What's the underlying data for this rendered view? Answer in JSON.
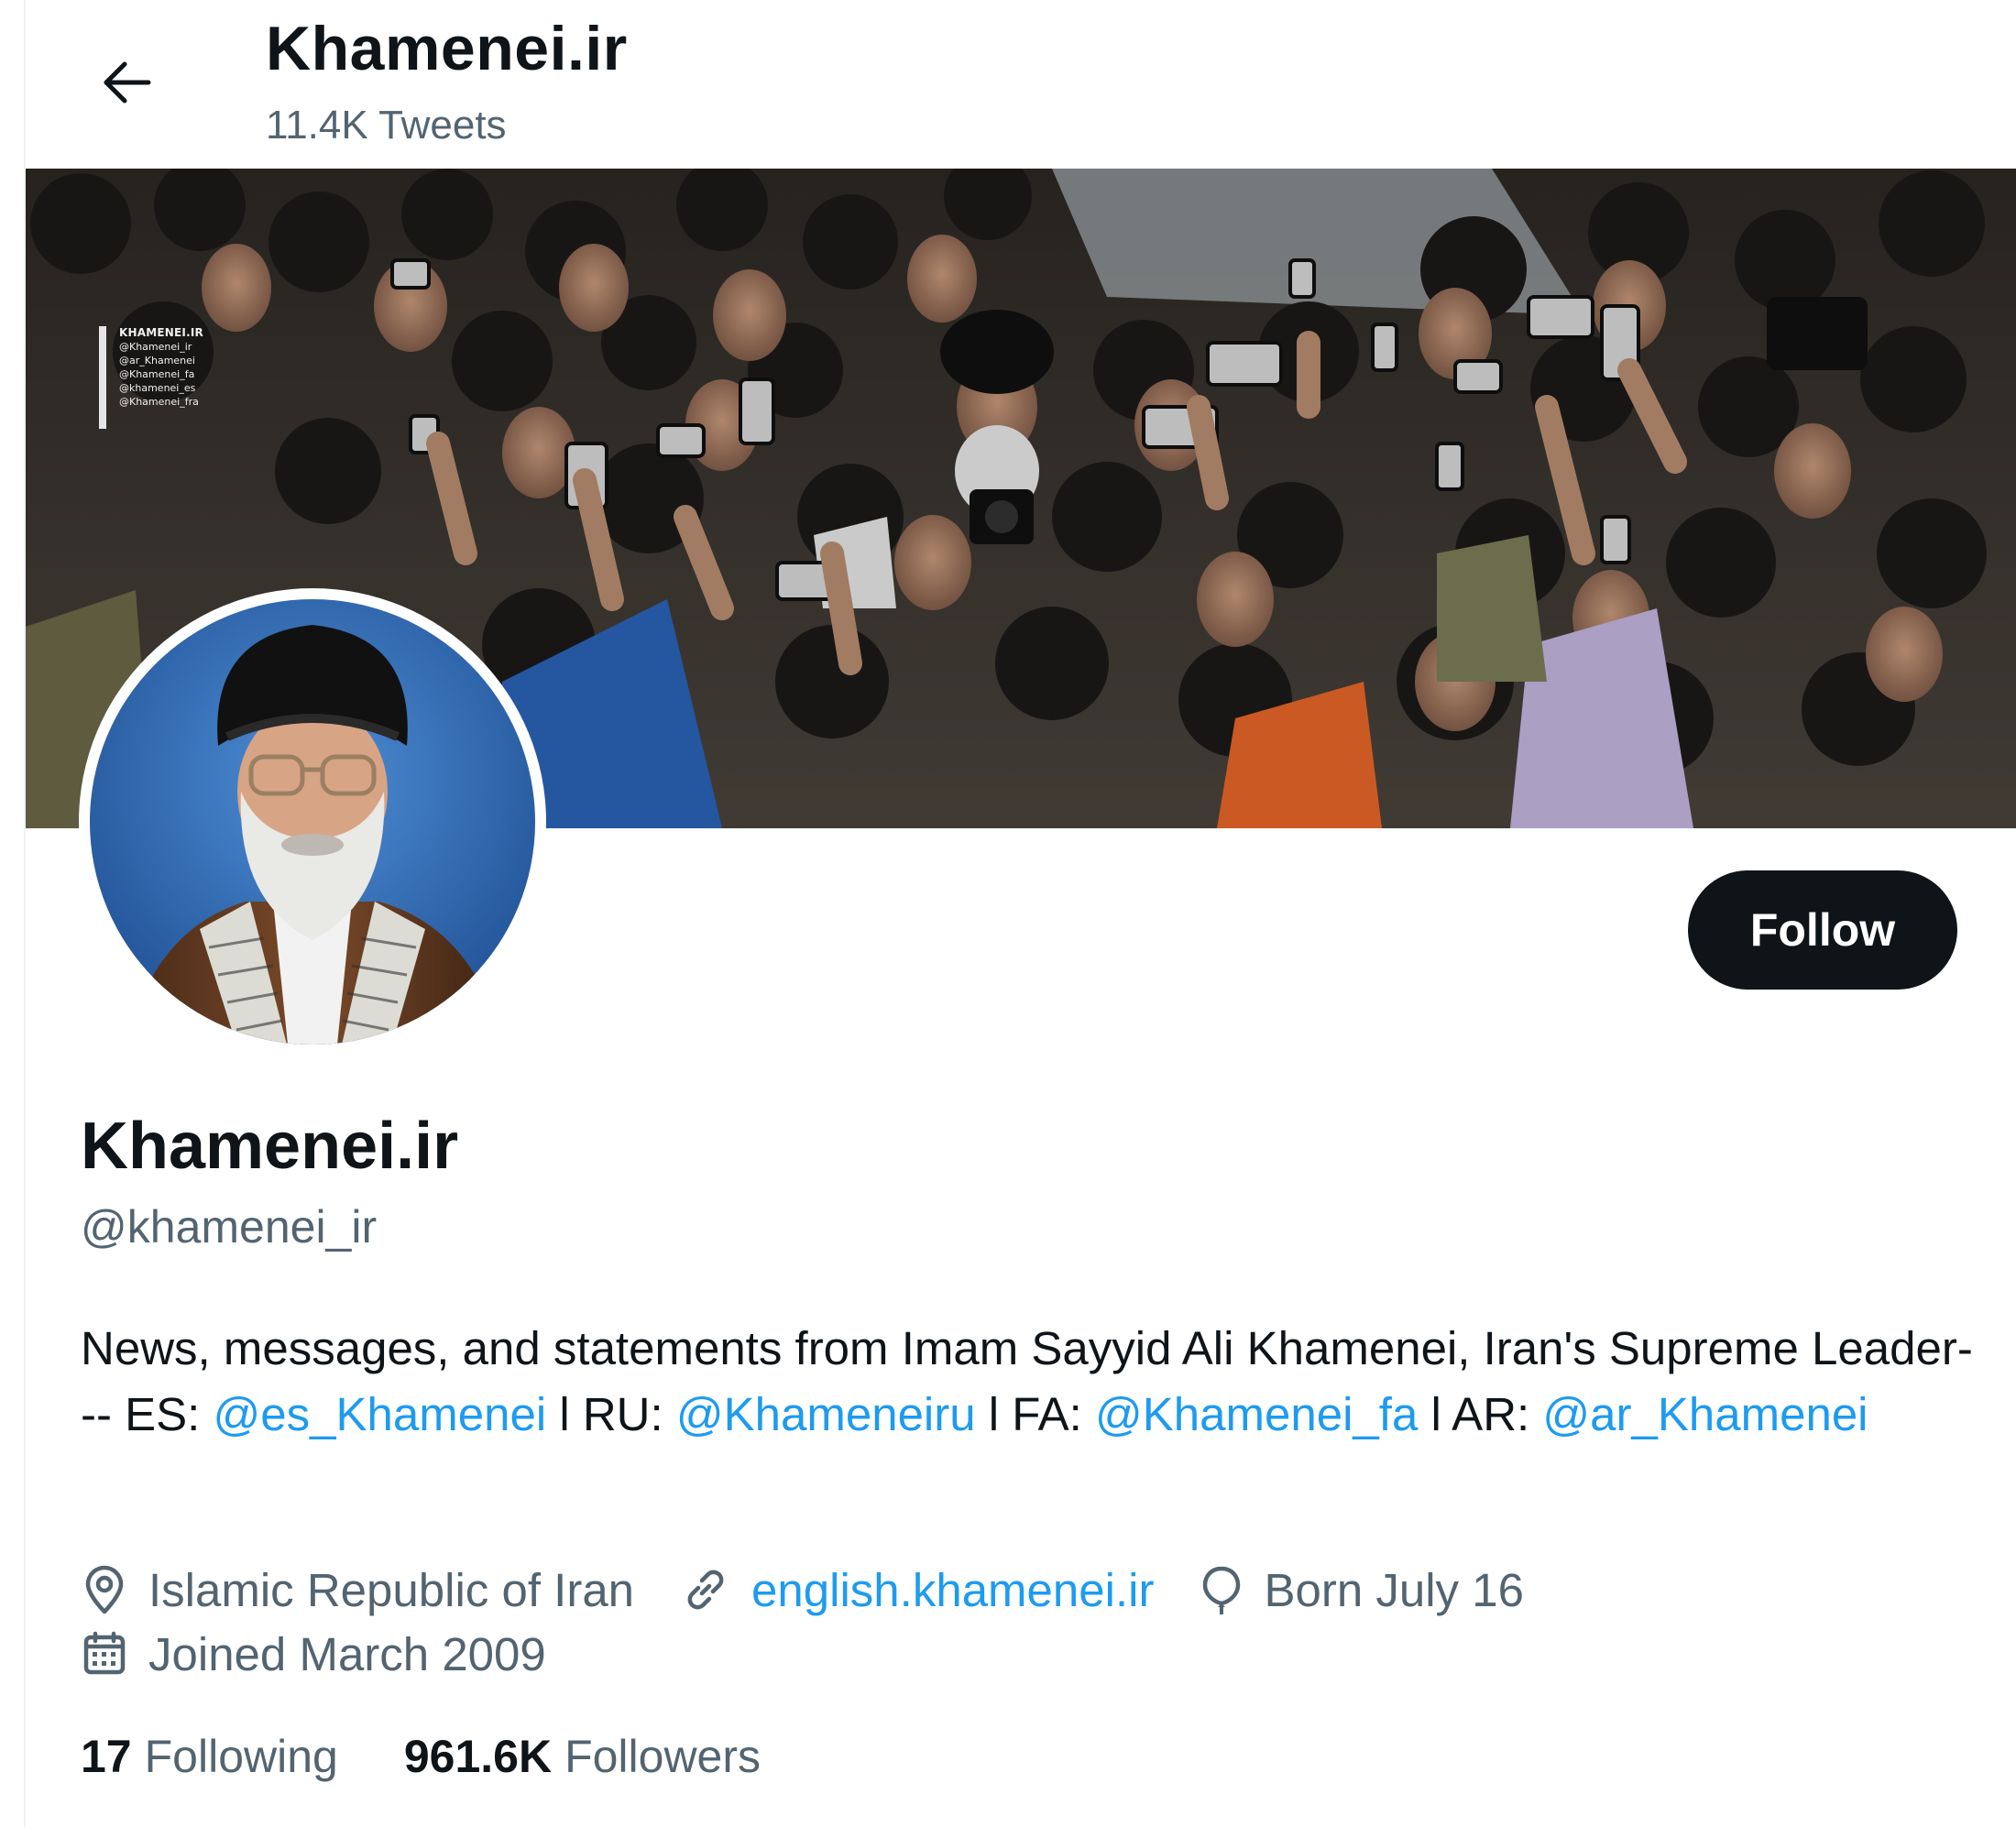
{
  "header": {
    "title": "Khamenei.ir",
    "tweets_count": "11.4K Tweets"
  },
  "banner": {
    "watermark": {
      "title": "KHAMENEI.IR",
      "handles": [
        "@Khamenei_ir",
        "@ar_Khamenei",
        "@Khamenei_fa",
        "@khamenei_es",
        "@Khamenei_fra"
      ]
    }
  },
  "profile": {
    "name": "Khamenei.ir",
    "handle": "@khamenei_ir",
    "follow_label": "Follow",
    "bio": {
      "text_1": "News, messages, and statements from Imam Sayyid Ali Khamenei, Iran's Supreme Leader--- ES: ",
      "link_es": "@es_Khamenei",
      "text_2": " l RU: ",
      "link_ru": "@Khameneiru",
      "text_3": " l FA: ",
      "link_fa": "@Khamenei_fa",
      "text_4": " l AR: ",
      "link_ar": "@ar_Khamenei"
    },
    "location": "Islamic Republic of Iran",
    "website": "english.khamenei.ir",
    "birthday": "Born July 16",
    "joined": "Joined March 2009"
  },
  "stats": {
    "following_count": "17",
    "following_label": "Following",
    "followers_count": "961.6K",
    "followers_label": "Followers"
  },
  "icons": {
    "back": "arrow-left-icon",
    "location": "location-pin-icon",
    "website": "link-icon",
    "birthday": "balloon-icon",
    "joined": "calendar-icon"
  },
  "colors": {
    "link": "#1d9bf0",
    "primary_text": "#0f1419",
    "secondary_text": "#536471",
    "button_bg": "#0f1419"
  }
}
